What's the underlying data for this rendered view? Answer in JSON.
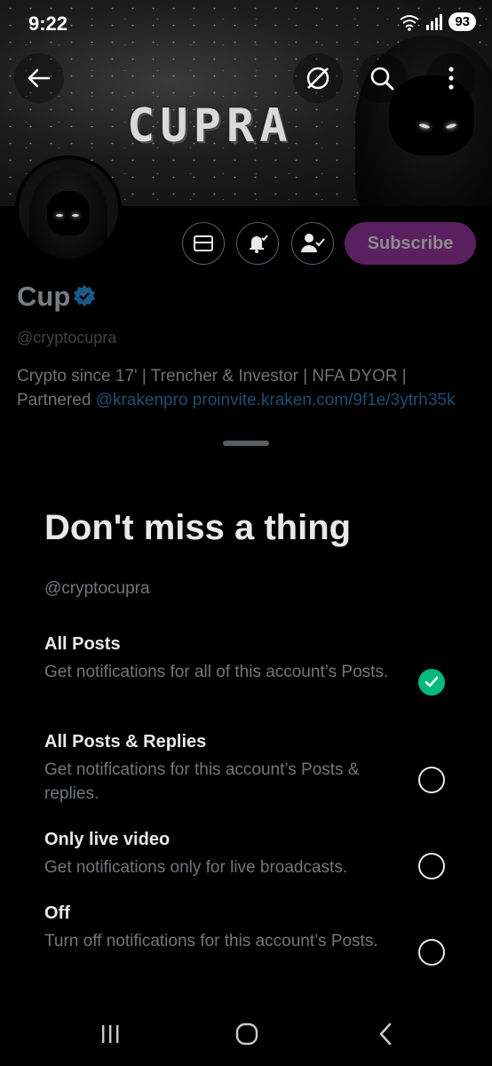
{
  "status": {
    "time": "9:22",
    "battery": "93"
  },
  "banner": {
    "logo_text": "CUPRA"
  },
  "profile": {
    "name": "Cup",
    "handle": "@cryptocupra",
    "bio_text": "Crypto since 17' | Trencher & Investor | NFA DYOR | Partnered ",
    "bio_mention": "@krakenpro",
    "bio_url": "proinvite.kraken.com/9f1e/3ytrh35k"
  },
  "actions": {
    "subscribe_label": "Subscribe"
  },
  "sheet": {
    "title": "Don't miss a thing",
    "handle": "@cryptocupra",
    "options": [
      {
        "title": "All Posts",
        "description": "Get notifications for all of this account’s Posts.",
        "selected": true
      },
      {
        "title": "All Posts & Replies",
        "description": "Get notifications for this account’s Posts & replies.",
        "selected": false
      },
      {
        "title": "Only live video",
        "description": "Get notifications only for live broadcasts.",
        "selected": false
      },
      {
        "title": "Off",
        "description": "Turn off notifications for this account’s Posts.",
        "selected": false
      }
    ]
  },
  "colors": {
    "accent_green": "#00ba7c",
    "subscribe_bg": "#5a1f5e",
    "link_blue": "#1d9bf0"
  },
  "icons": [
    "back-arrow-icon",
    "grok-icon",
    "search-icon",
    "more-vertical-icon",
    "mail-icon",
    "bell-icon",
    "person-check-icon",
    "verified-badge-icon",
    "recents-icon",
    "home-icon",
    "nav-back-icon"
  ]
}
